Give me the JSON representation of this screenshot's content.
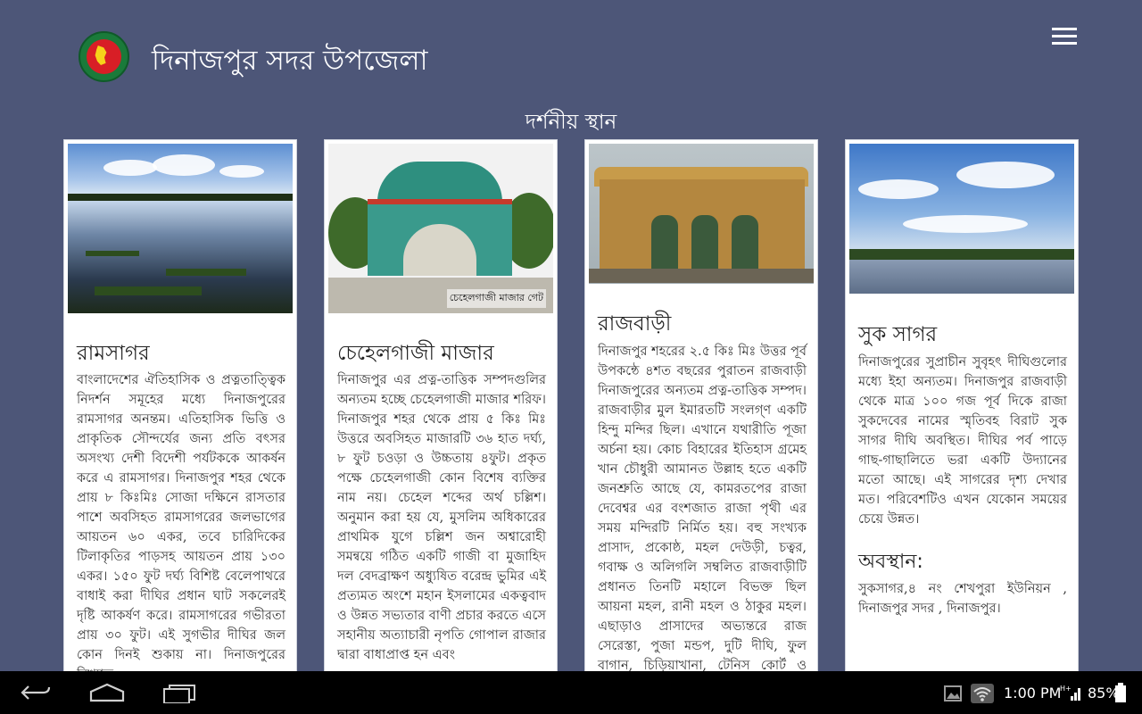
{
  "header": {
    "title": "দিনাজপুর সদর উপজেলা"
  },
  "section_title": "দর্শনীয় স্থান",
  "cards": [
    {
      "title": "রামসাগর",
      "body": "বাংলাদেশের ঐতিহাসিক ও প্রত্নতাত্ত্বিক নিদর্শন সমূহের মধ্যে দিনাজপুরের রামসাগর অনন্তম। এতিহাসিক ভিত্তি ও প্রাকৃতিক সৌন্দর্যের জন্য প্রতি বৎসর অসংখ্য দেশী বিদেশী পর্যটককে আকর্ষন করে এ রামসাগর। দিনাজপুর শহর থেকে প্রায় ৮ কিঃমিঃ সোজা দক্ষিনে রাসতার পাশে অবসিহত রামসাগরের জলভাগের আয়তন ৬০ একর, তবে চারিদিকের টিলাকৃতির পাড়সহ আয়তন প্রায় ১৩০ একর। ১৫০ ফুট দর্ঘ্য বিশিষ্ট বেলেপাথরে বাধাই করা দীঘির প্রধান ঘাট সকলেরই দৃষ্টি আকর্ষণ করে। রামসাগরের গভীরতা প্রায় ৩০ ফুট। এই সুগভীর দীঘির জল কোন দিনই শুকায় না। দিনাজপুরের বিখ্যাত"
    },
    {
      "title": "চেহেলগাজী মাজার",
      "photo_caption": "চেহেলগাজী মাজার গেট",
      "body": "দিনাজপুর এর প্রত্ন-তাত্তিক সম্পদগুলির অন্যতম হচ্ছে চেহেলগাজী মাজার শরিফ। দিনাজপুর শহর থেকে প্রায় ৫ কিঃ মিঃ উত্তরে অবসিহত মাজারটি ৩৬ হাত দর্ঘ্য, ৮ ফুট চওড়া ও উচ্চতায় ৪ফুট। প্রকৃত পক্ষে চেহেলগাজী কোন বিশেষ ব্যক্তির নাম নয়। চেহেল শব্দের অর্থ চল্লিশ। অনুমান করা হয় যে, মুসলিম অধিকারের প্রাথমিক যুগে চল্লিশ জন অশ্বারোহী সমন্বয়ে গঠিত একটি গাজী বা মুজাহিদ দল বেদব্রাক্ষণ অধ্যুষিত বরেন্দ্র ভুমির এই প্রত্যমত অংশে মহান ইসলামের একত্ববাদ ও উন্নত সভ্যতার বাণী প্রচার করতে এসে সহানীয় অত্যাচারী নৃপতি গোপাল রাজার দ্বারা বাধাপ্রাপ্ত হন এবং"
    },
    {
      "title": "রাজবাড়ী",
      "body": "দিনাজপুর শহরের ২.৫ কিঃ মিঃ উত্তর পূর্ব উপকন্ঠে ৪শত বছরের পুরাতন রাজবাড়ী দিনাজপুরের অন্যতম প্রত্ন-তাত্তিক সম্পদ। রাজবাড়ীর মুল ইমারতটি সংলগ্ণ একটি হিন্দু মন্দির ছিল। এখানে যথারীতি পূজা অর্চনা হয়। কোচ বিহারের ইতিহাস গ্রমেহ খান চৌধুরী আমানত উল্লাহ হতে একটি জনশ্রুতি আছে যে, কামরতপের রাজা দেবেশ্বর এর বংশজাত রাজা পৃথী এর সময় মন্দিরটি নির্মিত হয়। বহু সংখ্যক প্রাসাদ, প্রকোষ্ঠ, মহল দেউড়ী, চত্বর, গবাক্ষ ও অলিগলি সম্বলিত রাজবাড়ীটি প্রধানত তিনটি মহালে বিভক্ত ছিল আয়না মহল, রানী মহল ও ঠাকুর মহল। এছাড়াও প্রাসাদের অভ্যন্তরে রাজ সেরেস্তা, পুজা মন্ডপ, দুটি দীঘি, ফুল বাগান, চিড়িয়াখানা, টেনিস কোর্ট ও কুমার মহল"
    },
    {
      "title": "সুক সাগর",
      "body": "দিনাজপুরের সুপ্রাচীন সুবৃহৎ দীঘিগুলোর মধ্যে ইহা অন্যতম। দিনাজপুর রাজবাড়ী থেকে মাত্র ১০০ গজ পূর্ব দিকে রাজা সুকদেবের নামের স্মৃতিবহ বিরাট সুক সাগর দীঘি অবস্থিত। দীঘির পর্ব পাড়ে গাছ-গাছালিতে ভরা একটি উদ্যানের মতো আছে। এই সাগরের দৃশ্য দেখার মত। পরিবেশটিও এখন যেকোন সময়ের চেয়ে উন্নত।",
      "location_heading": "অবস্থান:",
      "location_text": "সুকসাগর,৪ নং শেখপুরা ইউনিয়ন , দিনাজপুর সদর , দিনাজপুর।"
    }
  ],
  "status_bar": {
    "time": "1:00 PM",
    "signal_label": "H+",
    "battery": "85%"
  },
  "colors": {
    "background": "#4d5678",
    "card": "#ffffff",
    "navbar": "#000000"
  }
}
